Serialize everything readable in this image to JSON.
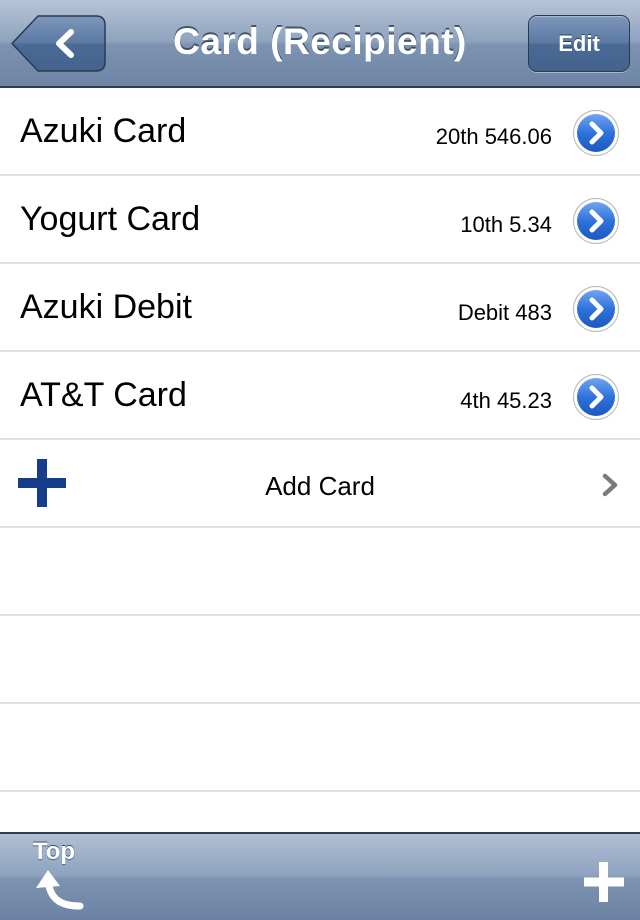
{
  "navbar": {
    "title": "Card (Recipient)",
    "back_icon": "chevron-left-icon",
    "edit_label": "Edit"
  },
  "cards": [
    {
      "name": "Azuki Card",
      "detail": "20th 546.06"
    },
    {
      "name": "Yogurt Card",
      "detail": "10th 5.34"
    },
    {
      "name": "Azuki Debit",
      "detail": "Debit 483"
    },
    {
      "name": "AT&T Card",
      "detail": "4th 45.23"
    }
  ],
  "add_row": {
    "label": "Add Card",
    "icon": "plus-icon",
    "accessory_icon": "chevron-right-icon"
  },
  "toolbar": {
    "top_label": "Top",
    "top_icon": "curved-up-arrow-icon",
    "add_icon": "plus-icon"
  },
  "colors": {
    "bar": "#8ea3bf",
    "disclosure": "#2b6fd6",
    "plus": "#163c8c",
    "separator": "#e0e0e0"
  }
}
